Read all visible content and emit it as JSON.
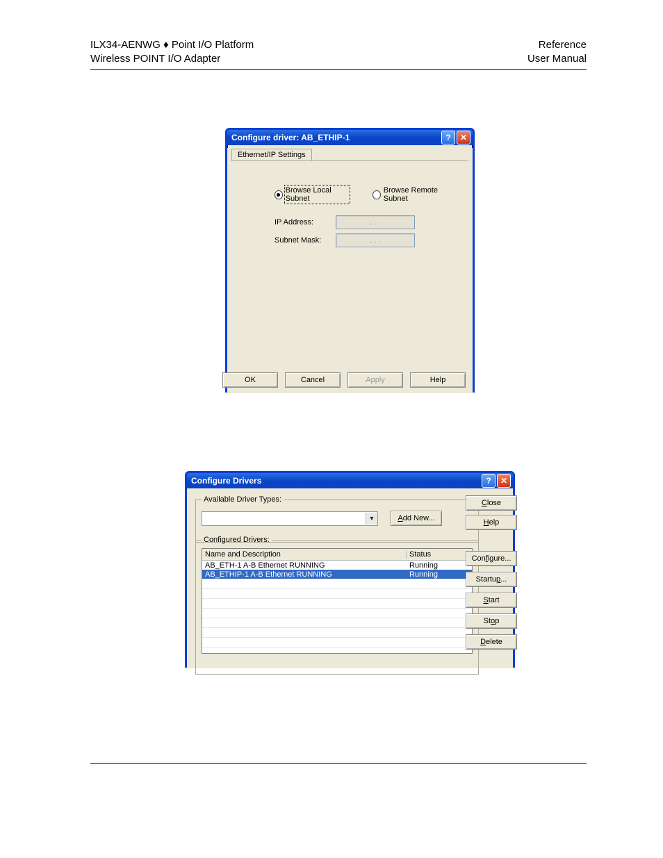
{
  "header": {
    "left_line1": "ILX34-AENWG ♦ Point I/O Platform",
    "left_line2": "Wireless POINT I/O Adapter",
    "right_line1": "Reference",
    "right_line2": "User Manual"
  },
  "dialog1": {
    "title": "Configure driver: AB_ETHIP-1",
    "tab_label": "Ethernet/IP Settings",
    "radio_local": "Browse Local Subnet",
    "radio_remote": "Browse Remote Subnet",
    "ip_label": "IP Address:",
    "subnet_label": "Subnet Mask:",
    "ip_value": ".     .     .",
    "subnet_value": ".     .     .",
    "btn_ok": "OK",
    "btn_cancel": "Cancel",
    "btn_apply": "Apply",
    "btn_help": "Help"
  },
  "dialog2": {
    "title": "Configure Drivers",
    "grp_types": "Available Driver Types:",
    "btn_addnew_pre": "A",
    "btn_addnew_rest": "dd New...",
    "grp_conf": "Configured Drivers:",
    "head_name": "Name and Description",
    "head_status": "Status",
    "rows": [
      {
        "name": "AB_ETH-1  A-B Ethernet  RUNNING",
        "status": "Running",
        "selected": false
      },
      {
        "name": "AB_ETHIP-1  A-B Ethernet  RUNNING",
        "status": "Running",
        "selected": true
      }
    ],
    "btn_close": "Close",
    "btn_help": "Help",
    "btn_configure": "Configure...",
    "btn_startup": "Startup...",
    "btn_start": "Start",
    "btn_stop": "Stop",
    "btn_delete": "Delete"
  }
}
